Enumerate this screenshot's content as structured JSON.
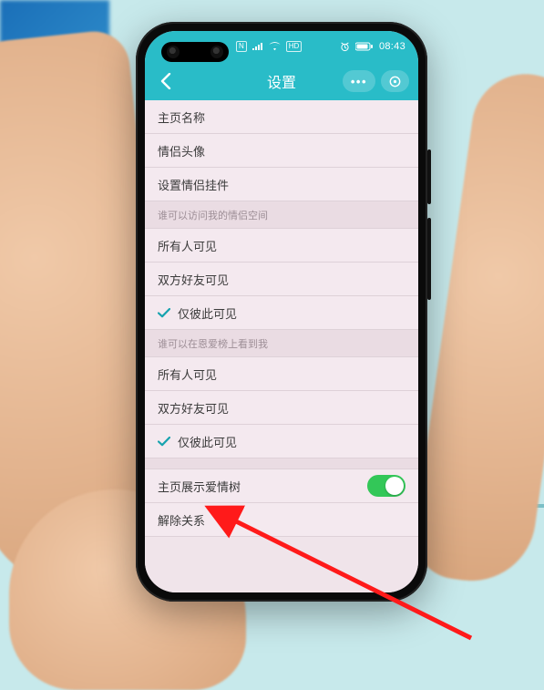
{
  "statusbar": {
    "carrier_hd": "HD",
    "nfc": "N",
    "time": "08:43"
  },
  "navbar": {
    "title": "设置",
    "more": "•••"
  },
  "general": {
    "homepage_name": "主页名称",
    "couple_avatar": "情侣头像",
    "set_pendant": "设置情侣挂件"
  },
  "section_visit": "谁可以访问我的情侣空间",
  "visit": {
    "all": "所有人可见",
    "friends": "双方好友可见",
    "only_us": "仅彼此可见"
  },
  "section_rank": "谁可以在恩爱榜上看到我",
  "rank": {
    "all": "所有人可见",
    "friends": "双方好友可见",
    "only_us": "仅彼此可见"
  },
  "bottom": {
    "show_tree": "主页展示爱情树",
    "unbind": "解除关系"
  }
}
